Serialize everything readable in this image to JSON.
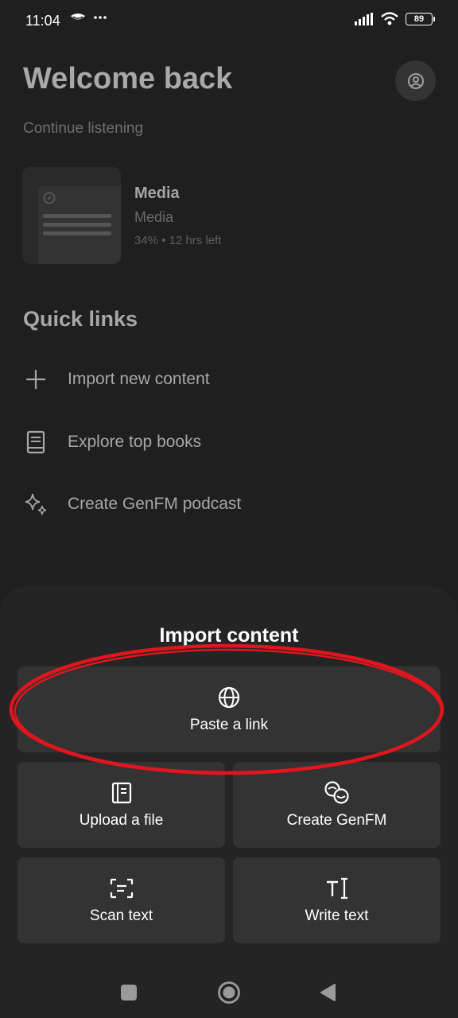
{
  "status_bar": {
    "time": "11:04",
    "battery": "89"
  },
  "home": {
    "title": "Welcome back",
    "continue_label": "Continue listening",
    "media": {
      "title": "Media",
      "subtitle": "Media",
      "progress": "34% • 12 hrs left"
    },
    "quick_links_title": "Quick links",
    "quick_links": [
      {
        "label": "Import new content",
        "icon": "plus-icon"
      },
      {
        "label": "Explore top books",
        "icon": "book-icon"
      },
      {
        "label": "Create GenFM podcast",
        "icon": "sparkle-icon"
      }
    ]
  },
  "sheet": {
    "title": "Import content",
    "options": [
      {
        "label": "Paste a link",
        "icon": "globe-icon"
      },
      {
        "label": "Upload a file",
        "icon": "file-icon"
      },
      {
        "label": "Create GenFM",
        "icon": "genfm-icon"
      },
      {
        "label": "Scan text",
        "icon": "scan-text-icon"
      },
      {
        "label": "Write text",
        "icon": "write-text-icon"
      }
    ]
  },
  "colors": {
    "background": "#1f1f1f",
    "sheet": "#242424",
    "tile": "#333333",
    "highlight": "#e0161e"
  }
}
